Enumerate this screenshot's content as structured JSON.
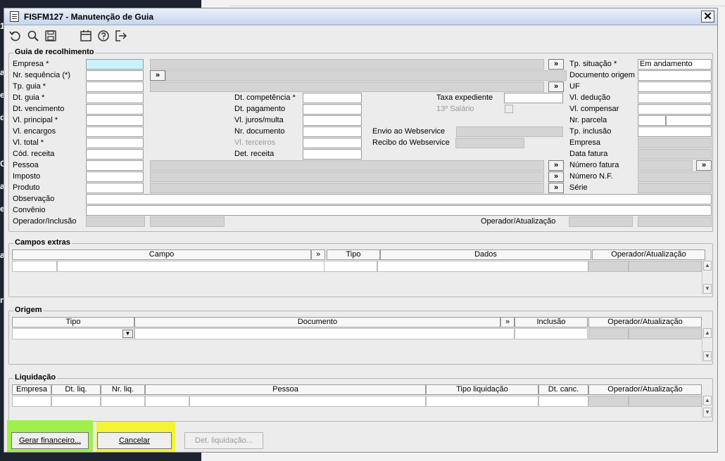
{
  "background": {
    "side_glyphs": [
      "1",
      "a",
      "e",
      "d",
      "C",
      "a",
      "et",
      "a",
      "n"
    ]
  },
  "window": {
    "title": "FISFM127 - Manutenção de Guia",
    "close_label": "✕"
  },
  "toolbar": [
    "undo-icon",
    "search-icon",
    "save-icon",
    "calendar-icon",
    "help-icon",
    "exit-icon"
  ],
  "guia": {
    "legend": "Guia de recolhimento",
    "labels": {
      "empresa": "Empresa *",
      "nr_sequencia": "Nr. sequência (*)",
      "tp_guia": "Tp. guia *",
      "dt_guia": "Dt. guia *",
      "dt_vencimento": "Dt. vencimento",
      "vl_principal": "Vl. principal *",
      "vl_encargos": "Vl. encargos",
      "vl_total": "Vl. total *",
      "cod_receita": "Cód. receita",
      "pessoa": "Pessoa",
      "imposto": "Imposto",
      "produto": "Produto",
      "observacao": "Observação",
      "convenio": "Convênio",
      "operador_inclusao": "Operador/Inclusão",
      "dt_competencia": "Dt. competência *",
      "dt_pagamento": "Dt. pagamento",
      "vl_juros_multa": "Vl. juros/multa",
      "nr_documento": "Nr. documento",
      "vl_terceiros": "Vl. terceiros",
      "det_receita": "Det. receita",
      "taxa_expediente": "Taxa expediente",
      "decimo_terceiro": "13º Salário",
      "envio_webservice": "Envio ao Webservice",
      "recibo_webservice": "Recibo do Webservice",
      "operador_atualizacao": "Operador/Atualização",
      "tp_situacao": "Tp. situação *",
      "documento_origem": "Documento origem",
      "uf": "UF",
      "vl_deducao": "Vl. dedução",
      "vl_compensar": "Vl. compensar",
      "nr_parcela": "Nr. parcela",
      "tp_inclusao": "Tp. inclusão",
      "empresa_r": "Empresa",
      "data_fatura": "Data fatura",
      "numero_fatura": "Número fatura",
      "numero_nf": "Número N.F.",
      "serie": "Série"
    },
    "values": {
      "tp_situacao": "Em andamento"
    },
    "lookup_label": "»"
  },
  "campos_extras": {
    "legend": "Campos extras",
    "columns": [
      "Campo",
      "»",
      "Tipo",
      "Dados",
      "Operador/Atualização"
    ]
  },
  "origem": {
    "legend": "Origem",
    "columns": [
      "Tipo",
      "Documento",
      "»",
      "Inclusão",
      "Operador/Atualização"
    ]
  },
  "liquidacao": {
    "legend": "Liquidação",
    "columns": [
      "Empresa",
      "Dt. liq.",
      "Nr. liq.",
      "Pessoa",
      "Tipo liquidação",
      "Dt. canc.",
      "Operador/Atualização"
    ]
  },
  "actions": {
    "gerar_financeiro": "Gerar financeiro...",
    "cancelar": "Cancelar",
    "det_liquidacao": "Det. liquidação..."
  },
  "colors": {
    "highlight_green": "#9ff04a",
    "highlight_yellow": "#f4f433",
    "focused_field": "#c8f3fb"
  }
}
